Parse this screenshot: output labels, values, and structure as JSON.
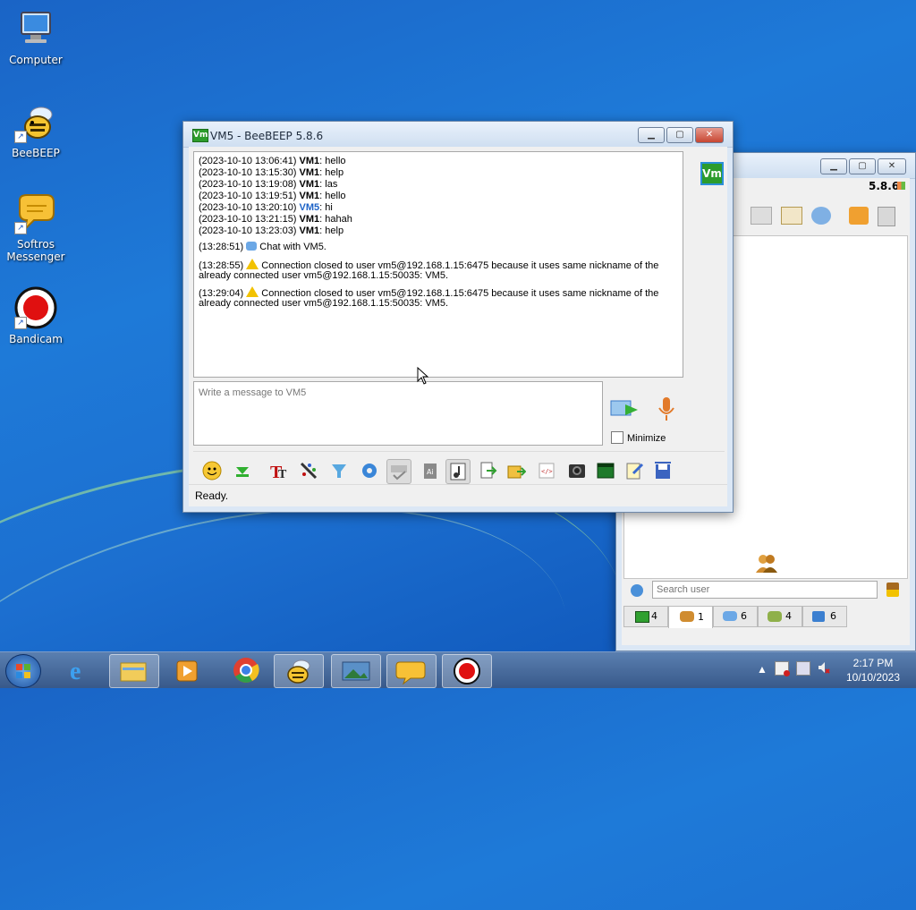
{
  "desktop": {
    "icons": [
      {
        "label": "Computer",
        "icon": "computer-icon"
      },
      {
        "label": "BeeBEEP",
        "icon": "bee-icon"
      },
      {
        "label": "Softros Messenger",
        "icon": "speech-bubble-icon"
      },
      {
        "label": "Bandicam",
        "icon": "record-icon"
      }
    ]
  },
  "main_window": {
    "version": "5.8.6",
    "search_placeholder": "Search user",
    "tabs": [
      {
        "icon": "green-monitor-icon",
        "count": "4"
      },
      {
        "icon": "users-icon",
        "count": "1"
      },
      {
        "icon": "chat-icon",
        "count": "6"
      },
      {
        "icon": "groups-icon",
        "count": "4"
      },
      {
        "icon": "files-icon",
        "count": "6"
      }
    ]
  },
  "chat_window": {
    "badge": "Vm",
    "title": "VM5 - BeeBEEP 5.8.6",
    "messages": [
      {
        "time": "(2023-10-10 13:06:41)",
        "nick": "VM1",
        "text": ": hello",
        "nick_color": "black"
      },
      {
        "time": "(2023-10-10 13:15:30)",
        "nick": "VM1",
        "text": ": help",
        "nick_color": "black"
      },
      {
        "time": "(2023-10-10 13:19:08)",
        "nick": "VM1",
        "text": ": las",
        "nick_color": "black"
      },
      {
        "time": "(2023-10-10 13:19:51)",
        "nick": "VM1",
        "text": ": hello",
        "nick_color": "black"
      },
      {
        "time": "(2023-10-10 13:20:10)",
        "nick": "VM5",
        "text": ": hi",
        "nick_color": "blue"
      },
      {
        "time": "(2023-10-10 13:21:15)",
        "nick": "VM1",
        "text": ": hahah",
        "nick_color": "black"
      },
      {
        "time": "(2023-10-10 13:23:03)",
        "nick": "VM1",
        "text": ": help",
        "nick_color": "black"
      }
    ],
    "system_chat": {
      "time": "(13:28:51)",
      "text": "Chat with VM5."
    },
    "warnings": [
      {
        "time": "(13:28:55)",
        "line1": "Connection closed to user vm5@192.168.1.15:6475 because it uses same nickname of the",
        "line2": "already connected user vm5@192.168.1.15:50035: VM5."
      },
      {
        "time": "(13:29:04)",
        "line1": "Connection closed to user vm5@192.168.1.15:6475 because it uses same nickname of the",
        "line2": "already connected user vm5@192.168.1.15:50035: VM5."
      }
    ],
    "input_placeholder": "Write a message to VM5",
    "minimize_label": "Minimize",
    "status": "Ready."
  },
  "taskbar": {
    "time": "2:17 PM",
    "date": "10/10/2023",
    "buttons": [
      "start-button",
      "internet-explorer",
      "file-explorer",
      "media-player",
      "chrome",
      "beebeep",
      "image-viewer",
      "softros-messenger",
      "bandicam"
    ]
  },
  "colors": {
    "accent": "#1d63c7",
    "badge_green": "#2c9c2c",
    "warning_yellow": "#f2c200"
  }
}
